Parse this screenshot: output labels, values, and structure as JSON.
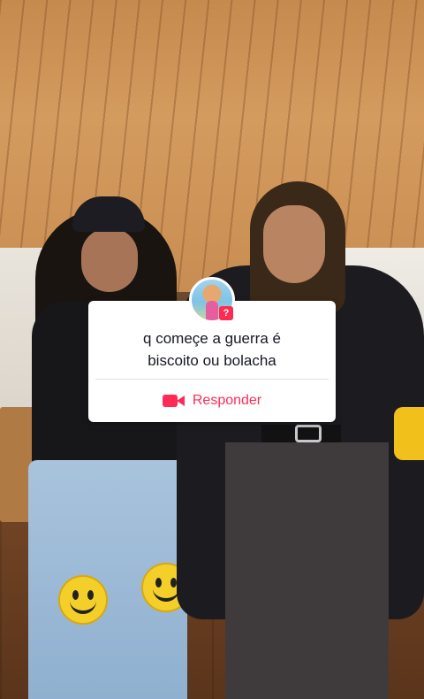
{
  "question_card": {
    "question": "q começe a guerra é\nbiscoito  ou bolacha",
    "reply_label": "Responder",
    "badge_text": "?",
    "accent_color": "#fe2c55"
  },
  "icons": {
    "reply": "video-camera-icon",
    "badge": "question-mark-icon"
  }
}
